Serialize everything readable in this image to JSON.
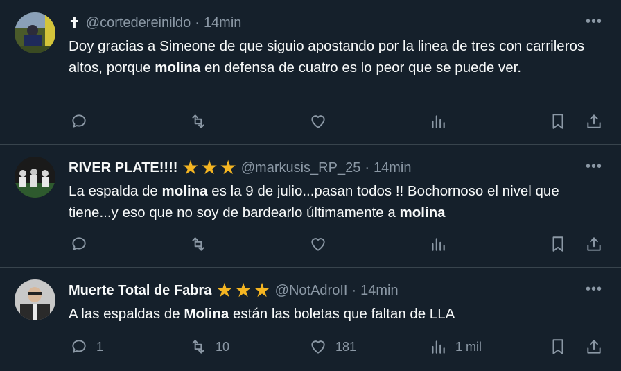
{
  "tweets": [
    {
      "prefix": "✝",
      "name": "",
      "handle": "@cortedereinildo",
      "time": "14min",
      "body": [
        {
          "t": "Doy gracias a Simeone de que siguio apostando por la linea de tres con carrileros altos, porque ",
          "b": false
        },
        {
          "t": "molina",
          "b": true
        },
        {
          "t": " en defensa de cuatro es lo peor que se puede ver.",
          "b": false
        }
      ],
      "stats": {
        "replies": "",
        "retweets": "",
        "likes": "",
        "views": ""
      }
    },
    {
      "prefix": "",
      "name": "RIVER PLATE!!!!",
      "handle": "@markusis_RP_25",
      "time": "14min",
      "stars": [
        "★",
        "★",
        "★"
      ],
      "body": [
        {
          "t": "La espalda de ",
          "b": false
        },
        {
          "t": "molina",
          "b": true
        },
        {
          "t": " es la 9 de julio...pasan todos !! Bochornoso el nivel que tiene...y eso que no soy de bardearlo últimamente a ",
          "b": false
        },
        {
          "t": "molina",
          "b": true
        }
      ],
      "stats": {
        "replies": "",
        "retweets": "",
        "likes": "",
        "views": ""
      }
    },
    {
      "prefix": "",
      "name": "Muerte Total de Fabra",
      "handle": "@NotAdroII",
      "time": "14min",
      "stars": [
        "★",
        "★",
        "★"
      ],
      "body": [
        {
          "t": "A las espaldas de ",
          "b": false
        },
        {
          "t": "Molina",
          "b": true
        },
        {
          "t": " están las boletas que faltan de LLA",
          "b": false
        }
      ],
      "stats": {
        "replies": "1",
        "retweets": "10",
        "likes": "181",
        "views": "1 mil"
      }
    }
  ],
  "more": "•••",
  "colors": {
    "background": "#15202b",
    "text": "#f7f9f9",
    "muted": "#8b98a5",
    "divider": "#38444d",
    "star": "#f4b522"
  },
  "icons": [
    "reply-icon",
    "retweet-icon",
    "like-icon",
    "views-icon",
    "bookmark-icon",
    "share-icon",
    "more-icon"
  ]
}
